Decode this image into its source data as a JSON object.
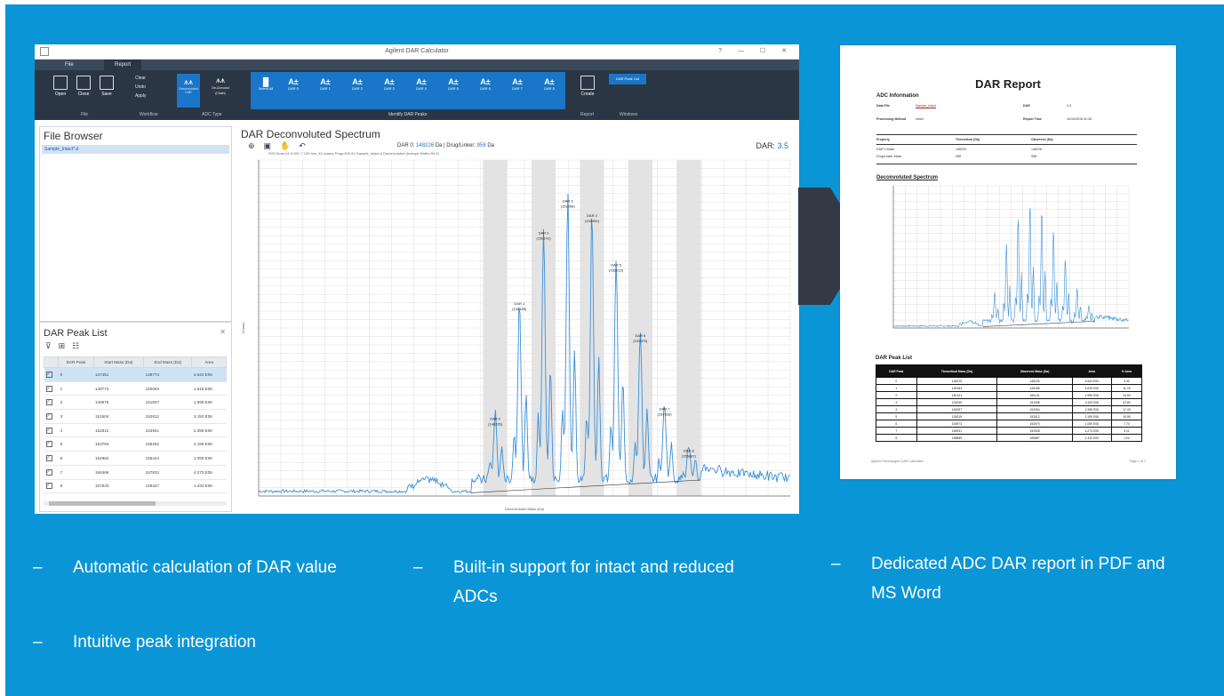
{
  "app": {
    "window_title": "Agilent DAR Calculator",
    "window_controls": "? — ☐ ✕",
    "tabs": [
      "File",
      "Report"
    ],
    "ribbon": {
      "file_buttons": [
        "Open",
        "Close",
        "Save"
      ],
      "file_group": "File",
      "small_buttons": [
        "Clear",
        "Undo",
        "Apply"
      ],
      "small_group": "Workflow",
      "type_buttons": [
        "Deconvoluted DAR",
        "De-Convolut (Chain)"
      ],
      "type_group": "ADC Type",
      "at_buttons": [
        "Select All",
        "DAR 0",
        "DAR 1",
        "DAR 2",
        "DAR 3",
        "DAR 4",
        "DAR 5",
        "DAR 6",
        "DAR 7",
        "DAR 8"
      ],
      "at_group": "Identify DAR Peaks",
      "report_button": "Create",
      "report_group": "Report",
      "dar_peak_list_button": "DAR Peak List",
      "window_group": "Windows"
    },
    "file_browser": {
      "title": "File Browser",
      "file": "Sample_Intact*.d"
    },
    "peak_list": {
      "title": "DAR Peak List",
      "columns": [
        "DAR Peak",
        "Start Mass (Da)",
        "End Mass (Da)",
        "Area"
      ],
      "rows": [
        [
          "0",
          "147451",
          "148774",
          "4.544 E05"
        ],
        [
          "1",
          "148774",
          "150063",
          "1.619 E06"
        ],
        [
          "2",
          "149975",
          "151507",
          "1.995 E06"
        ],
        [
          "3",
          "151604",
          "152812",
          "3.150 E06"
        ],
        [
          "4",
          "152812",
          "153941",
          "2.398 E06"
        ],
        [
          "5",
          "153794",
          "155252",
          "2.195 E06"
        ],
        [
          "6",
          "154962",
          "156444",
          "1.059 E06"
        ],
        [
          "7",
          "156466",
          "157832",
          "4.273 E05"
        ],
        [
          "8",
          "157833",
          "159447",
          "1.433 E05"
        ]
      ]
    },
    "spectrum": {
      "title": "DAR Deconvoluted Spectrum",
      "dar0_label": "DAR 0:",
      "dar0_value": "148226",
      "dar0_unit": "Da",
      "drug_label": "Drug/Linker:",
      "drug_value": "958",
      "drug_unit": "Da",
      "dar_label": "DAR:",
      "dar_value": "3.5",
      "subtitle": "+ESI Scan (rt: 5.997-7.139 min, 40 scans) Frag=300.0V Sample_Intact.d Deconvoluted (Isotope Width=94.0)",
      "xlabel": "Deconvoluted Mass (Da)",
      "ylabel": "Counts"
    }
  },
  "report": {
    "title": "DAR Report",
    "adc_info_heading": "ADC Information",
    "data_file_label": "Data File",
    "data_file_value": "Sample_Intact",
    "dar_label": "DAR",
    "dar_value": "3.5",
    "method_label": "Processing Method",
    "method_value": "Intact",
    "report_time_label": "Report Time",
    "report_time_value": "10/10/2018 02:38",
    "props_headers": [
      "Property",
      "Theoretical (Da)",
      "Observed (Da)"
    ],
    "props_rows": [
      [
        "DAR 0 Mass",
        "148225",
        "148226"
      ],
      [
        "Drug/Linker Mass",
        "958",
        "958"
      ]
    ],
    "spectrum_heading": "Deconvoluted Spectrum",
    "peak_list_heading": "DAR Peak List",
    "peak_headers": [
      "DAR Peak",
      "Theoretical Mass (Da)",
      "Observed Mass (Da)",
      "Area",
      "% Area"
    ],
    "peak_rows": [
      [
        "0",
        "148225",
        "148226",
        "4.544 E05",
        "3.30"
      ],
      [
        "1",
        "149183",
        "149185",
        "1.619 E06",
        "11.76"
      ],
      [
        "2",
        "150141",
        "150141",
        "1.995 E06",
        "14.50"
      ],
      [
        "3",
        "151099",
        "151098",
        "3.150 E06",
        "22.89"
      ],
      [
        "4",
        "152057",
        "152054",
        "2.398 E06",
        "17.43"
      ],
      [
        "5",
        "153015",
        "153012",
        "2.195 E06",
        "15.95"
      ],
      [
        "6",
        "153973",
        "153970",
        "1.059 E06",
        "7.70"
      ],
      [
        "7",
        "154931",
        "154928",
        "4.273 E05",
        "3.11"
      ],
      [
        "8",
        "155889",
        "155887",
        "1.433 E05",
        "1.04"
      ]
    ],
    "footer_left": "Agilent Technologies DAR Calculator",
    "footer_right": "Page 1 of 1"
  },
  "bullets": {
    "col1": [
      "Automatic calculation of DAR value",
      "Intuitive peak integration"
    ],
    "col2": [
      "Built-in support for intact and reduced ADCs"
    ],
    "col3": [
      "Dedicated ADC DAR report in PDF and MS Word"
    ]
  },
  "colors": {
    "panel": "#0a95d6",
    "ribbon": "#2a3644",
    "accent": "#1a76c8",
    "arrow": "#333a45",
    "trace": "#3a8fd6"
  },
  "chart_data": {
    "type": "line",
    "xlabel": "Deconvoluted Mass (Da)",
    "ylabel": "Counts",
    "ylim": [
      0,
      2.1
    ],
    "peaks": [
      {
        "label": "DAR 0",
        "mass": "148226",
        "y": 0.42
      },
      {
        "label": "DAR 1",
        "mass": "149185",
        "y": 1.14
      },
      {
        "label": "DAR 2",
        "mass": "150141",
        "y": 1.58
      },
      {
        "label": "DAR 3",
        "mass": "151098",
        "y": 1.78
      },
      {
        "label": "DAR 4",
        "mass": "152054",
        "y": 1.69
      },
      {
        "label": "DAR 5",
        "mass": "153012",
        "y": 1.38
      },
      {
        "label": "DAR 6",
        "mass": "153970",
        "y": 0.94
      },
      {
        "label": "DAR 7",
        "mass": "154928",
        "y": 0.48
      },
      {
        "label": "DAR 8",
        "mass": "155887",
        "y": 0.22
      }
    ]
  }
}
